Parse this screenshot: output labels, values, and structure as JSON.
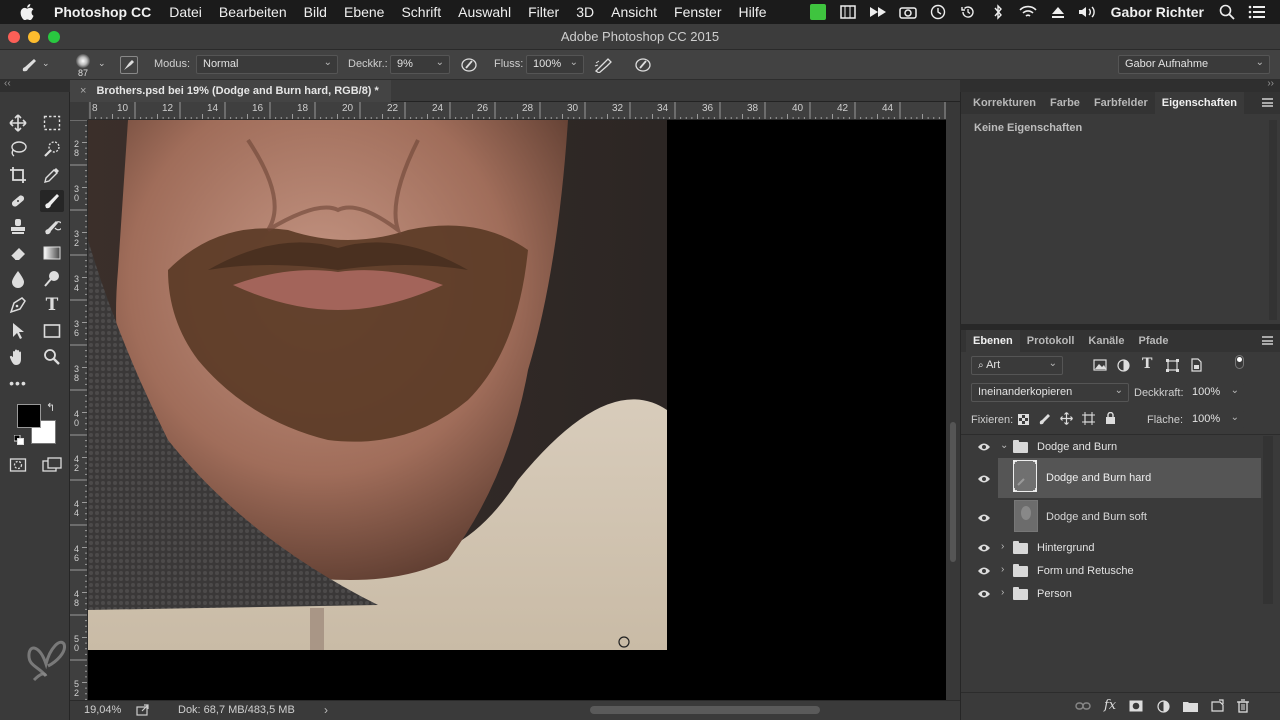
{
  "menubar": {
    "app_name": "Photoshop CC",
    "items": [
      "Datei",
      "Bearbeiten",
      "Bild",
      "Ebene",
      "Schrift",
      "Auswahl",
      "Filter",
      "3D",
      "Ansicht",
      "Fenster",
      "Hilfe"
    ],
    "user": "Gabor Richter"
  },
  "window": {
    "title": "Adobe Photoshop CC 2015"
  },
  "options_bar": {
    "brush_size": "87",
    "mode_label": "Modus:",
    "mode_value": "Normal",
    "opacity_label": "Deckkr.:",
    "opacity_value": "9%",
    "flow_label": "Fluss:",
    "flow_value": "100%",
    "workspace": "Gabor Aufnahme"
  },
  "document": {
    "tab_title": "Brothers.psd bei 19% (Dodge and Burn hard, RGB/8) *",
    "ruler_h": [
      "8",
      "10",
      "12",
      "14",
      "16",
      "18",
      "20",
      "22",
      "24",
      "26",
      "28",
      "30",
      "32",
      "34",
      "36",
      "38",
      "40",
      "42",
      "44"
    ],
    "ruler_v": [
      "28",
      "30",
      "32",
      "34",
      "36",
      "38",
      "40",
      "42",
      "44",
      "46",
      "48",
      "50",
      "52"
    ]
  },
  "status": {
    "zoom": "19,04%",
    "doc_info": "Dok: 68,7 MB/483,5 MB"
  },
  "properties_panel": {
    "tabs": [
      "Korrekturen",
      "Farbe",
      "Farbfelder",
      "Eigenschaften"
    ],
    "active_tab": "Eigenschaften",
    "empty_text": "Keine Eigenschaften"
  },
  "layers_panel": {
    "tabs": [
      "Ebenen",
      "Protokoll",
      "Kanäle",
      "Pfade"
    ],
    "active_tab": "Ebenen",
    "filter_kind": "Art",
    "blend_mode": "Ineinanderkopieren",
    "opacity_label": "Deckkraft:",
    "opacity_value": "100%",
    "lock_label": "Fixieren:",
    "fill_label": "Fläche:",
    "fill_value": "100%",
    "layers": [
      {
        "name": "Dodge and Burn",
        "type": "group",
        "expanded": true
      },
      {
        "name": "Dodge and Burn hard",
        "type": "layer",
        "selected": true
      },
      {
        "name": "Dodge and Burn soft",
        "type": "layer"
      },
      {
        "name": "Hintergrund",
        "type": "group"
      },
      {
        "name": "Form und Retusche",
        "type": "group"
      },
      {
        "name": "Person",
        "type": "group"
      }
    ]
  },
  "colors": {
    "foreground": "#000000",
    "background": "#ffffff",
    "panel_bg": "#3a3a3a",
    "selected_layer": "#555555"
  }
}
